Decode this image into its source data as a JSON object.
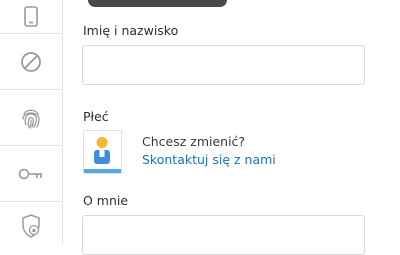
{
  "sidebar": {
    "items": [
      {
        "icon": "phone-icon"
      },
      {
        "icon": "block-icon"
      },
      {
        "icon": "fingerprint-icon"
      },
      {
        "icon": "key-icon"
      },
      {
        "icon": "shield-lock-icon"
      }
    ]
  },
  "form": {
    "name_label": "Imię i nazwisko",
    "name_value": "",
    "gender_label": "Płeć",
    "gender_question": "Chcesz zmienić?",
    "gender_link": "Skontaktuj się z nami",
    "about_label": "O mnie",
    "about_value": ""
  },
  "colors": {
    "link": "#1a73b8",
    "avatar_head": "#f5b731",
    "avatar_body": "#3b8fd9",
    "avatar_base": "#57a6e8"
  }
}
